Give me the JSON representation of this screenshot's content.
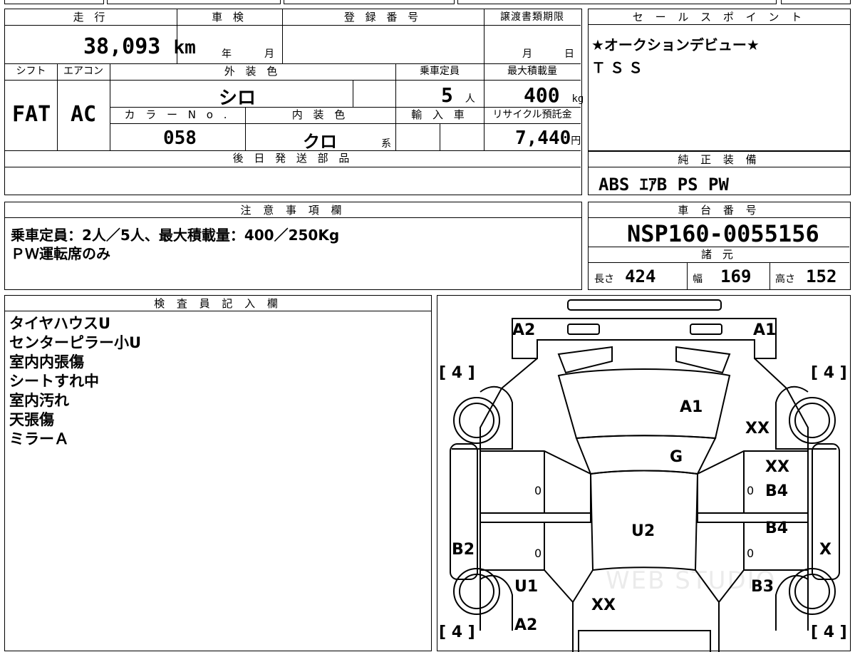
{
  "mileage": {
    "label": "走 行",
    "value": "38,093",
    "unit": "km"
  },
  "inspection": {
    "label": "車 検",
    "year_unit": "年",
    "month_unit": "月"
  },
  "registration": {
    "label": "登 録 番 号",
    "value": ""
  },
  "transfer_deadline": {
    "label": "譲渡書類期限",
    "month_unit": "月",
    "day_unit": "日"
  },
  "shift": {
    "label": "シフト",
    "value": "FAT"
  },
  "aircon": {
    "label": "エアコン",
    "value": "AC"
  },
  "exterior_color": {
    "label": "外 装 色",
    "value": "シロ"
  },
  "capacity": {
    "label": "乗車定員",
    "value": "5",
    "unit": "人"
  },
  "max_load": {
    "label": "最大積載量",
    "value": "400",
    "unit": "kg"
  },
  "color_no": {
    "label": "カ ラ ー N o .",
    "value": "058"
  },
  "interior_color": {
    "label": "内 装 色",
    "value": "クロ",
    "suffix": "系"
  },
  "import": {
    "label": "輸 入 車",
    "value": ""
  },
  "recycle_fee": {
    "label": "リサイクル預託金",
    "value": "7,440",
    "unit": "円"
  },
  "later_parts": {
    "label": "後 日 発 送 部 品",
    "value": ""
  },
  "sales_points": {
    "label": "セ ー ル ス ポ イ ン ト",
    "lines": [
      "★オークションデビュー★",
      "ＴＳＳ"
    ]
  },
  "equipment": {
    "label": "純 正 装 備",
    "value": "ABS ｴｱB PS PW"
  },
  "notes": {
    "label": "注 意 事 項 欄",
    "lines": [
      "乗車定員：2人／5人、最大積載量：400／250Kg",
      "ＰＷ運転席のみ"
    ]
  },
  "chassis": {
    "label": "車 台 番 号",
    "value": "NSP160-0055156"
  },
  "specs": {
    "label": "諸 元",
    "length_label": "長さ",
    "length": "424",
    "width_label": "幅",
    "width": "169",
    "height_label": "高さ",
    "height": "152"
  },
  "inspector": {
    "label": "検 査 員 記 入 欄",
    "lines": [
      "タイヤハウスU",
      "センターピラー小U",
      "室内内張傷",
      "シートすれ中",
      "室内汚れ",
      "天張傷",
      "ミラーＡ"
    ]
  },
  "diagram": {
    "tires": {
      "front_left": "[ 4 ]",
      "front_right": "[ 4 ]",
      "rear_left": "[ 4 ]",
      "rear_right": "[ 4 ]"
    },
    "marks": {
      "front_left_corner": "A2",
      "front_right_corner": "A1",
      "bonnet": "A1",
      "right_front_fender": "XX",
      "windshield": "G",
      "right_front_door_upper": "XX",
      "right_front_door": "B4",
      "right_front_door_zero": "0",
      "right_rear_door": "B4",
      "right_rear_door_zero": "0",
      "right_side": "X",
      "left_front_door_zero": "0",
      "left_rear_door_zero": "0",
      "left_side": "B2",
      "roof": "U2",
      "left_rear_fender": "U1",
      "right_rear_fender": "B3",
      "trunk": "XX",
      "rear_left": "A2"
    },
    "watermark": "WEB STUDIO"
  }
}
